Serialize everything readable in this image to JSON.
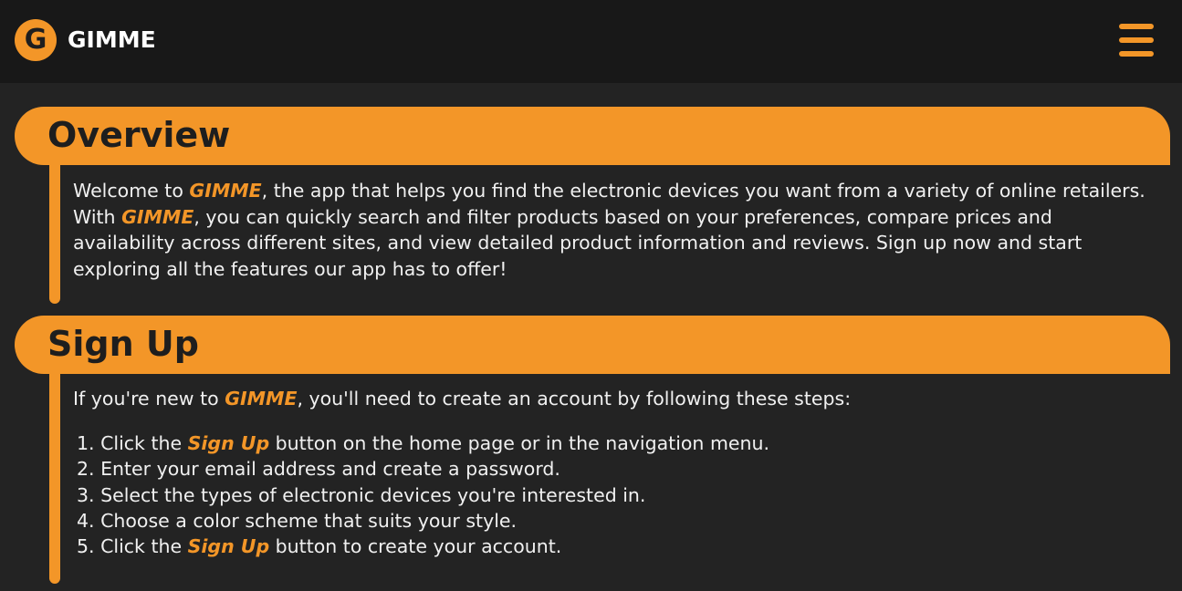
{
  "app": {
    "logo_letter": "G",
    "name": "GIMME"
  },
  "colors": {
    "accent": "#f39628",
    "background": "#232323",
    "topbar": "#181818",
    "text": "#f0f0f0"
  },
  "icons": {
    "menu": "hamburger-menu-icon"
  },
  "overview": {
    "title": "Overview",
    "p_1": "Welcome to ",
    "brand_1": "GIMME",
    "p_2": ", the app that helps you find the electronic devices you want from a variety of online retailers. With ",
    "brand_2": "GIMME",
    "p_3": ", you can quickly search and filter products based on your preferences, compare prices and availability across different sites, and view detailed product information and reviews. Sign up now and start exploring all the features our app has to offer!"
  },
  "signup": {
    "title": "Sign Up",
    "intro_1": "If you're new to ",
    "intro_brand": "GIMME",
    "intro_2": ", you'll need to create an account by following these steps:",
    "steps": [
      {
        "num": "1.",
        "pre": " Click the ",
        "em": "Sign Up",
        "post": " button on the home page or in the navigation menu."
      },
      {
        "num": "2.",
        "text": " Enter your email address and create a password."
      },
      {
        "num": "3.",
        "text": " Select the types of electronic devices you're interested in."
      },
      {
        "num": "4.",
        "text": " Choose a color scheme that suits your style."
      },
      {
        "num": "5.",
        "pre": " Click the ",
        "em": "Sign Up",
        "post": " button to create your account."
      }
    ]
  }
}
